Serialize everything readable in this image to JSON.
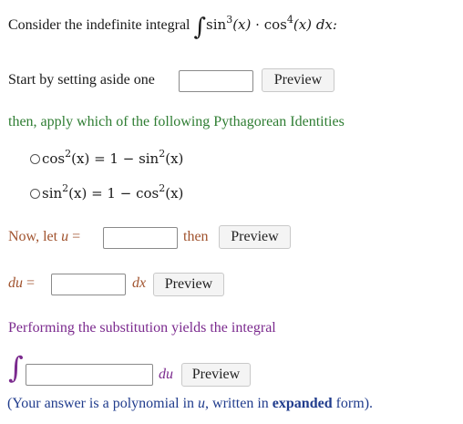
{
  "problem": {
    "intro": "Consider the indefinite integral",
    "integrand_sin": "sin",
    "integrand_sin_exp": "3",
    "integrand_cos": "cos",
    "integrand_cos_exp": "4",
    "integrand_var": "(x)",
    "dot": "·",
    "dx": "dx:"
  },
  "step1": {
    "label": "Start by setting aside one",
    "input_value": "",
    "preview_label": "Preview"
  },
  "step2": {
    "question": "then, apply which of the following Pythagorean Identities",
    "options": [
      {
        "lhs": "cos",
        "lhs_exp": "2",
        "mid": "(x) = 1 − ",
        "rhs": "sin",
        "rhs_exp": "2",
        "tail": "(x)"
      },
      {
        "lhs": "sin",
        "lhs_exp": "2",
        "mid": "(x) = 1 − ",
        "rhs": "cos",
        "rhs_exp": "2",
        "tail": "(x)"
      }
    ]
  },
  "step3": {
    "now_let": "Now, let",
    "var": "u",
    "equals": "=",
    "input_value": "",
    "then": "then",
    "preview_label": "Preview"
  },
  "step4": {
    "du_label": "du",
    "equals": "=",
    "input_value": "",
    "dx_label": "dx",
    "preview_label": "Preview"
  },
  "step5": {
    "text": "Performing the substitution yields the integral",
    "input_value": "",
    "du_label": "du",
    "preview_label": "Preview",
    "note_prefix": "(Your answer is a polynomial in",
    "note_var": "u",
    "note_mid": ", written in",
    "note_bold": "expanded",
    "note_suffix": "form)."
  },
  "colors": {
    "green": "#2e7d32",
    "brown": "#a0522d",
    "purple": "#7b2a8e",
    "blue": "#1f3b8c"
  }
}
